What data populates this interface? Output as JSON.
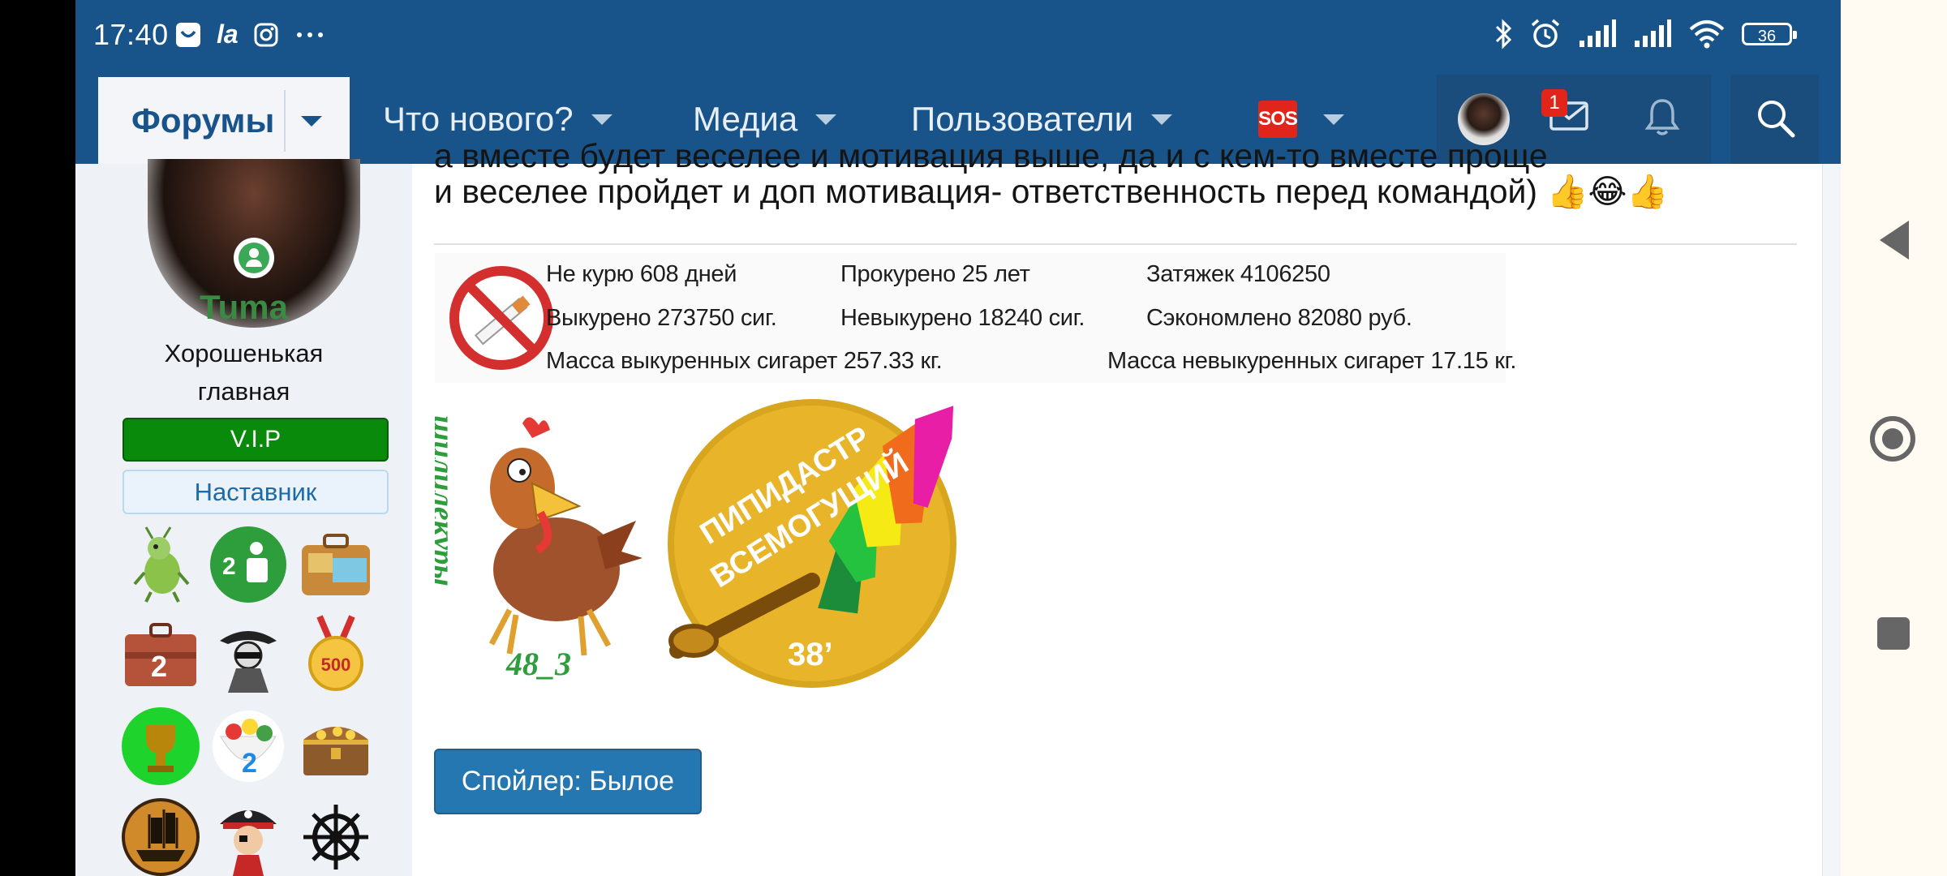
{
  "status_bar": {
    "time": "17:40",
    "left_icons": [
      "bag-icon",
      "la-icon",
      "instagram-icon",
      "more-dots-icon"
    ],
    "la_text": "la",
    "right_icons": [
      "bluetooth-icon",
      "alarm-icon",
      "signal-icon",
      "signal-icon",
      "wifi-icon",
      "battery-icon"
    ],
    "battery": "36"
  },
  "nav": {
    "forums": "Форумы",
    "whats_new": "Что нового?",
    "media": "Медиа",
    "users": "Пользователи",
    "sos": "SOS",
    "inbox_badge": "1"
  },
  "user": {
    "name": "Tuma",
    "title": "Хорошенькая главная",
    "banner_vip": "V.I.P",
    "banner_mentor": "Наставник",
    "trophies": [
      "bug-trophy",
      "two-people-trophy",
      "suitcase-map-trophy",
      "suitcase-2-trophy",
      "spy-trophy",
      "medal-500-trophy",
      "gold-cup-trophy",
      "candy-2-trophy",
      "treasure-chest-trophy",
      "ship-trophy",
      "pirate-trophy",
      "helm-trophy"
    ]
  },
  "post": {
    "line_cut": "а вместе будет веселее и мотивация выше, да и с кем-то вместе проще",
    "line2": "и веселее пройдет и доп мотивация- ответственность перед командой) 👍😂👍"
  },
  "smoke_stats": {
    "not_smoking": "Не курю 608 дней",
    "smoked_years": "Прокурено 25 лет",
    "puffs": "Затяжек 4106250",
    "smoked_cigs": "Выкурено 273750 сиг.",
    "not_smoked_cigs": "Невыкурено 18240 сиг.",
    "saved": "Сэкономлено 82080 руб.",
    "mass_smoked": "Масса выкуренных сигарет 257.33 кг.",
    "mass_not_smoked": "Масса невыкуренных сигарет 17.15 кг."
  },
  "images": {
    "rooster_caption": "48_3",
    "rooster_side_text": "шилилекуры",
    "duster_text1": "ПИПИДАСТР",
    "duster_text2": "ВСЕМОГУЩИЙ",
    "duster_number": "38’"
  },
  "spoiler": {
    "label": "Спойлер: Былое"
  }
}
